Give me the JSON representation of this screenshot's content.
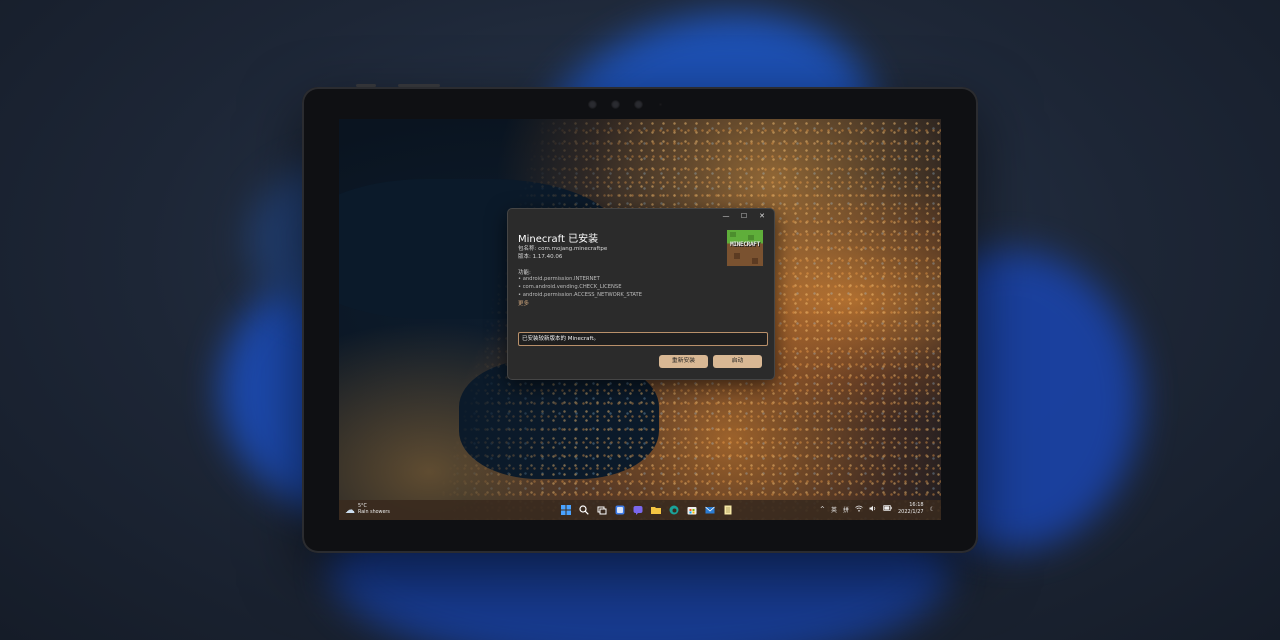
{
  "dialog": {
    "title": "Minecraft 已安装",
    "package_line": "包名称: com.mojang.minecraftpe",
    "version_line": "版本: 1.17.40.06",
    "capabilities_label": "功能:",
    "permissions": [
      "• android.permission.INTERNET",
      "• com.android.vending.CHECK_LICENSE",
      "• android.permission.ACCESS_NETWORK_STATE"
    ],
    "more_label": "更多",
    "status_text": "已安装较新版本的 Minecraft。",
    "reinstall_label": "重新安装",
    "launch_label": "启动",
    "icon_text": "MINECRAFT",
    "controls": {
      "minimize": "—",
      "maximize": "☐",
      "close": "✕"
    }
  },
  "taskbar": {
    "weather_temp": "5°C",
    "weather_desc": "Rain showers",
    "time": "16:18",
    "date": "2022/1/27",
    "ime": "英",
    "ime_mode": "拼",
    "chevron": "^"
  },
  "colors": {
    "accent": "#d9b894",
    "dialog_bg": "#2b2b2b",
    "taskbar_bg": "#3a2a1e"
  }
}
